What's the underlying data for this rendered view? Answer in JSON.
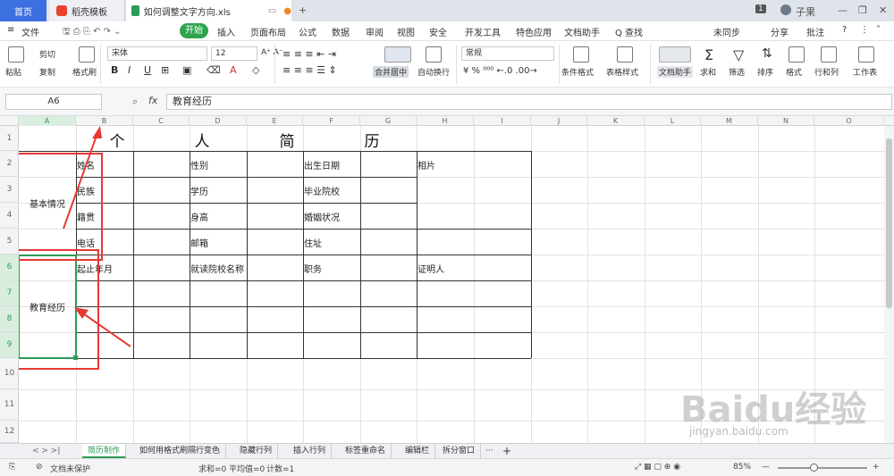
{
  "tabs": {
    "home": "首页",
    "template": "稻壳模板",
    "file": "如何调整文字方向.xls",
    "add": "+",
    "badge": "1",
    "user": "子果"
  },
  "menu": {
    "file": "文件",
    "start": "开始",
    "items": [
      "插入",
      "页面布局",
      "公式",
      "数据",
      "审阅",
      "视图",
      "安全",
      "开发工具",
      "特色应用",
      "文档助手"
    ],
    "search": "Q 查找",
    "sync": "未同步",
    "share": "分享",
    "comment": "批注",
    "help": "?"
  },
  "ribbon": {
    "paste": "粘贴",
    "cut": "剪切",
    "copy": "复制",
    "format_painter": "格式刷",
    "font": "宋体",
    "size": "12",
    "bold": "B",
    "italic": "I",
    "underline": "U",
    "merge": "合并居中",
    "wrap": "自动换行",
    "number_format": "常规",
    "cond_format": "条件格式",
    "table_style": "表格样式",
    "doc_assist": "文档助手",
    "sum": "求和",
    "filter": "筛选",
    "sort": "排序",
    "format": "格式",
    "rowcol": "行和列",
    "worksheet": "工作表"
  },
  "formula": {
    "cell_ref": "A6",
    "fx": "fx",
    "value": "教育经历"
  },
  "columns": [
    "A",
    "B",
    "C",
    "D",
    "E",
    "F",
    "G",
    "H",
    "I",
    "J",
    "K",
    "L",
    "M",
    "N",
    "O"
  ],
  "rows": [
    "1",
    "2",
    "3",
    "4",
    "5",
    "6",
    "7",
    "8",
    "9",
    "10",
    "11",
    "12"
  ],
  "cells": {
    "title": [
      "个",
      "人",
      "简",
      "历"
    ],
    "basic": "基本情况",
    "edu": "教育经历",
    "name": "姓名",
    "gender": "性别",
    "birth": "出生日期",
    "photo": "相片",
    "ethnic": "民族",
    "degree": "学历",
    "school": "毕业院校",
    "native": "籍贯",
    "height": "身高",
    "marital": "婚姻状况",
    "phone": "电话",
    "email": "邮箱",
    "address": "住址",
    "period": "起止年月",
    "school_name": "就读院校名称",
    "position": "职务",
    "witness": "证明人"
  },
  "sheets": [
    "简历制作",
    "如何用格式刷隔行变色",
    "隐藏行列",
    "插入行列",
    "标签重命名",
    "编辑栏",
    "拆分窗口"
  ],
  "status": {
    "protect": "文档未保护",
    "sum": "求和=0",
    "avg": "平均值=0",
    "count": "计数=1",
    "zoom": "85%"
  },
  "watermark": "Baidu经验",
  "watermark_url": "jingyan.baidu.com",
  "colors": {
    "accent": "#2ea44f",
    "annotation": "#e53935",
    "selection": "#2e9b57"
  }
}
